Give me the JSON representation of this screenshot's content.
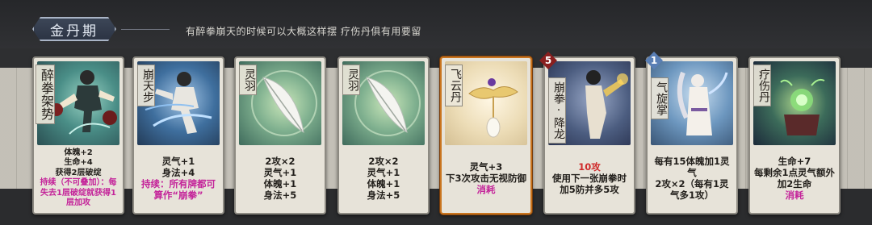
{
  "header": {
    "stage": "金丹期",
    "subtitle": "有醉拳崩天的时候可以大概这样摆 疗伤丹俱有用要留"
  },
  "cards": [
    {
      "name": "醉拳架势",
      "art_icon": "drunken-fist-stance-figure",
      "lines": [
        "体魄+2",
        "生命+4",
        "获得2层破绽"
      ],
      "extra": "持续（不可叠加）：每失去1层破绽就获得1层加攻"
    },
    {
      "name": "崩天步",
      "art_icon": "sky-breaking-step-figure",
      "lines": [
        "灵气+1",
        "身法+4"
      ],
      "extra": "持续：所有牌都可算作“崩拳”"
    },
    {
      "name": "灵羽",
      "art_icon": "spirit-feather",
      "lines": [
        "2攻×2",
        "灵气+1",
        "体魄+1",
        "身法+5"
      ]
    },
    {
      "name": "灵羽",
      "art_icon": "spirit-feather",
      "lines": [
        "2攻×2",
        "灵气+1",
        "体魄+1",
        "身法+5"
      ]
    },
    {
      "name": "飞云丹",
      "art_icon": "flying-cloud-pill",
      "lines": [
        "灵气+3",
        "下3次攻击无视防御",
        "消耗"
      ]
    },
    {
      "name": "崩拳·降龙",
      "badge": "5",
      "art_icon": "dragon-subduing-fist-figure",
      "lines": [
        "10攻",
        "使用下一张崩拳时加5防并多5攻"
      ]
    },
    {
      "name": "气旋掌",
      "badge": "1",
      "art_icon": "qi-vortex-palm-figure",
      "lines": [
        "每有15体魄加1灵气",
        "2攻×2（每有1灵气多1攻）"
      ]
    },
    {
      "name": "疗伤丹",
      "art_icon": "healing-pill-cauldron",
      "lines": [
        "生命+7",
        "每剩余1点灵气额外加2生命",
        "消耗"
      ]
    }
  ],
  "colors": {
    "buff_blue": "#2f6fd1",
    "attack_red": "#cf2a2a",
    "keyword_magenta": "#c4249a",
    "selected_border": "#c9741e"
  }
}
